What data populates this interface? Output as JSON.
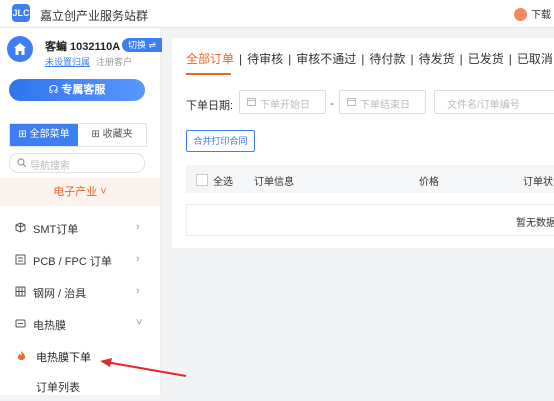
{
  "app": {
    "logo_text": "JLC",
    "title": "嘉立创产业服务站群",
    "download": "下载"
  },
  "user": {
    "name": "客蝙 1032110A",
    "switch_label": "切换 ⇌",
    "unset_name": "未设置归属",
    "customer_type": "注册客户",
    "service_button": "专属客服"
  },
  "menu": {
    "tab_all": "全部菜单",
    "tab_fav": "收藏夹",
    "search_placeholder": "导航搜索",
    "industry": "电子产业 ˅",
    "items": [
      {
        "label": "SMT订单",
        "icon": "cube-icon"
      },
      {
        "label": "PCB / FPC 订单",
        "icon": "board-icon"
      },
      {
        "label": "钢网 / 治具",
        "icon": "grid-icon"
      },
      {
        "label": "电热膜",
        "icon": "film-icon"
      }
    ],
    "sub_items": [
      {
        "label": "电热膜下单",
        "icon": "flame-icon"
      },
      {
        "label": "订单列表"
      }
    ]
  },
  "orders": {
    "tabs": [
      "全部订单",
      "待审核",
      "审核不通过",
      "待付款",
      "待发货",
      "已发货",
      "已取消"
    ],
    "active_tab": 0,
    "date_label": "下单日期:",
    "start_placeholder": "下单开始日",
    "end_placeholder": "下单结束日",
    "keyword_placeholder": "文件名/订单编号",
    "print_button": "合并打印合同",
    "columns": {
      "select_all": "全选",
      "info": "订单信息",
      "price": "价格",
      "status": "订单状"
    },
    "empty_text": "暂无数据"
  },
  "colors": {
    "primary": "#3c7ff2",
    "accent": "#e5672a"
  }
}
